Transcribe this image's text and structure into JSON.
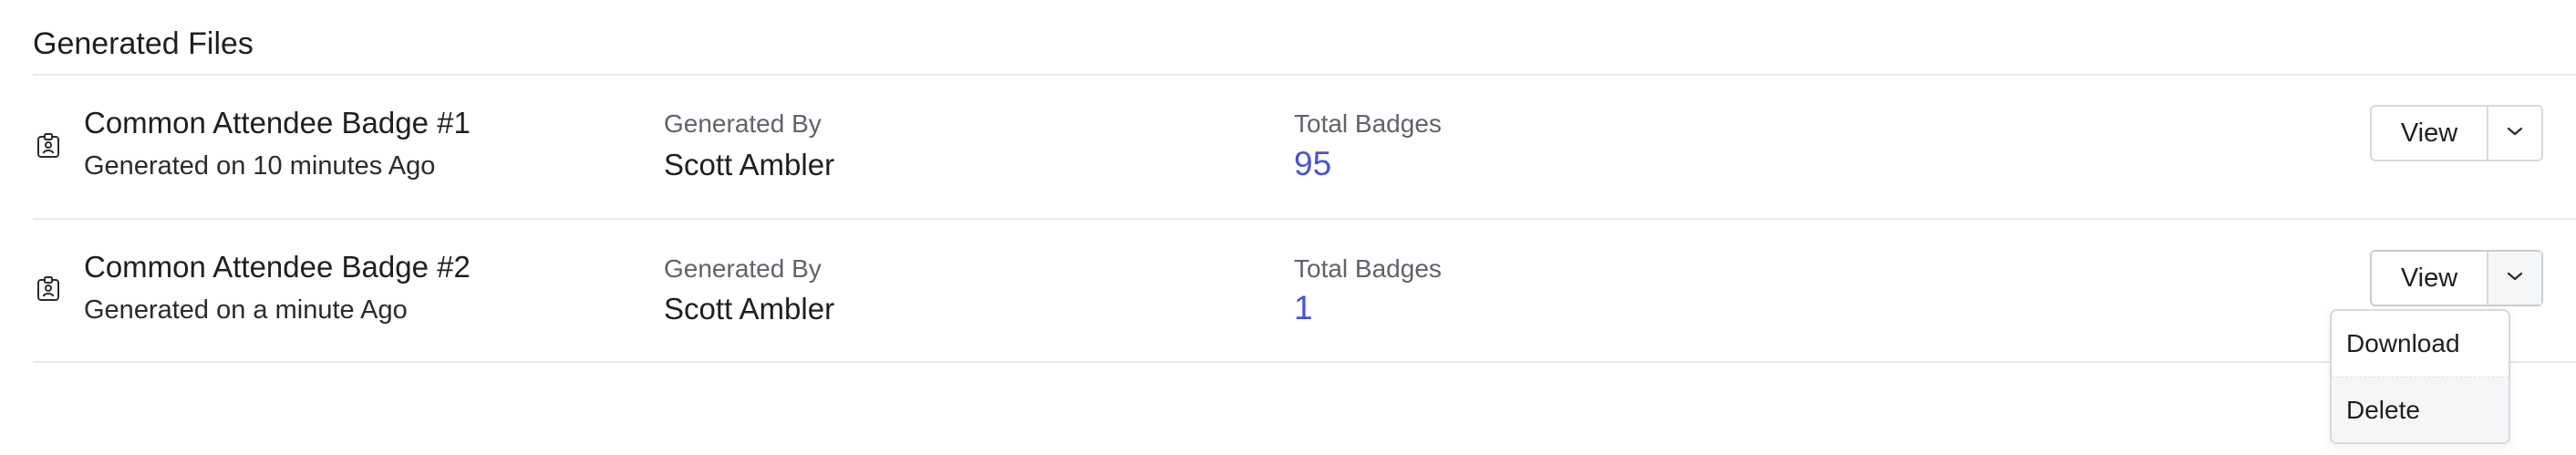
{
  "section": {
    "title": "Generated Files"
  },
  "files": [
    {
      "name": "Common Attendee Badge #1",
      "generated_on": "Generated on 10 minutes Ago",
      "generated_by_label": "Generated By",
      "generated_by": "Scott Ambler",
      "total_label": "Total Badges",
      "total": "95",
      "view_label": "View",
      "icon": "id-badge-icon"
    },
    {
      "name": "Common Attendee Badge #2",
      "generated_on": "Generated on a minute Ago",
      "generated_by_label": "Generated By",
      "generated_by": "Scott Ambler",
      "total_label": "Total Badges",
      "total": "1",
      "view_label": "View",
      "icon": "id-badge-icon"
    }
  ],
  "dropdown_menu": {
    "items": [
      {
        "label": "Download"
      },
      {
        "label": "Delete"
      }
    ]
  },
  "colors": {
    "accent_count": "#4a52d6",
    "divider": "#e6e8ec",
    "border": "#d6d9de"
  }
}
